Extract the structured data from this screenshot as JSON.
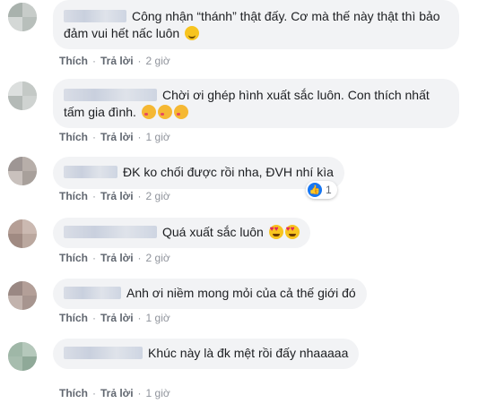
{
  "comments": [
    {
      "text": "Công nhận “thánh” thật đấy. Cơ mà thế này thật thì bảo đảm vui hết nấc luôn",
      "emoji": "smile",
      "actions": {
        "like": "Thích",
        "reply": "Trả lời",
        "time": "2 giờ"
      }
    },
    {
      "text": "Chời ơi ghép hình xuất sắc luôn. Con thích nhất tấm gia đình.",
      "emoji": "kiss",
      "actions": {
        "like": "Thích",
        "reply": "Trả lời",
        "time": "1 giờ"
      }
    },
    {
      "text": "ĐK ko chối được rồi nha, ĐVH nhí kìa",
      "actions": {
        "like": "Thích",
        "reply": "Trả lời",
        "time": "2 giờ"
      },
      "reaction": {
        "icon": "like-icon",
        "count": "1"
      }
    },
    {
      "text": "Quá xuất sắc luôn",
      "emoji": "heart-eyes",
      "actions": {
        "like": "Thích",
        "reply": "Trả lời",
        "time": "2 giờ"
      }
    },
    {
      "text": "Anh ơi niềm mong mỏi của cả thế giới đó",
      "actions": {
        "like": "Thích",
        "reply": "Trả lời",
        "time": "1 giờ"
      }
    },
    {
      "text": "Khúc này là đk mệt rồi đấy nhaaaaa",
      "actions": {
        "like": "Thích",
        "reply": "Trả lời",
        "time": "1 giờ"
      }
    }
  ],
  "colors": {
    "bubble": "#f2f3f5",
    "text": "#1c1e21",
    "action": "#606770",
    "like_blue": "#1877f2"
  }
}
